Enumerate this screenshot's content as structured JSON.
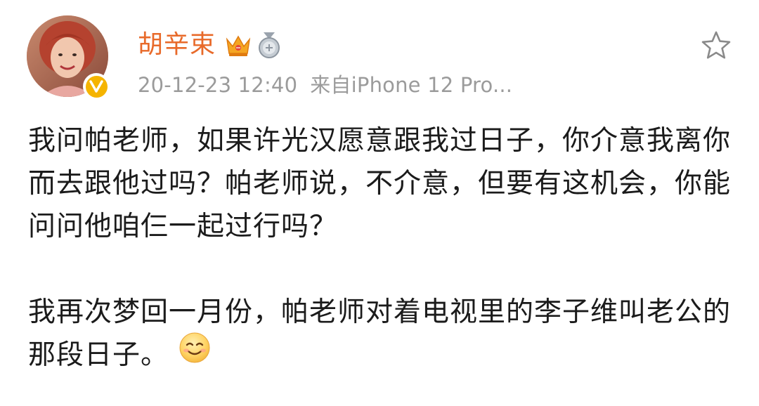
{
  "post": {
    "author": {
      "name": "胡辛束",
      "avatar": "avatar",
      "verified_badge_icon": "verified-v-icon",
      "verified_color": "#f5b400",
      "badges": [
        "crown-vip-icon",
        "medal-icon"
      ],
      "name_color": "#e86a2a"
    },
    "meta": {
      "timestamp": "20-12-23 12:40",
      "source": "来自iPhone 12 Pro..."
    },
    "favorite_icon": "star-outline-icon",
    "content": {
      "paragraph1": "我问帕老师，如果许光汉愿意跟我过日子，你介意我离你而去跟他过吗？帕老师说，不介意，但要有这机会，你能问问他咱仨一起过行吗？",
      "paragraph2": "我再次梦回一月份，帕老师对着电视里的李子维叫老公的那段日子。",
      "emoji": "smiling-face-emoji"
    }
  }
}
